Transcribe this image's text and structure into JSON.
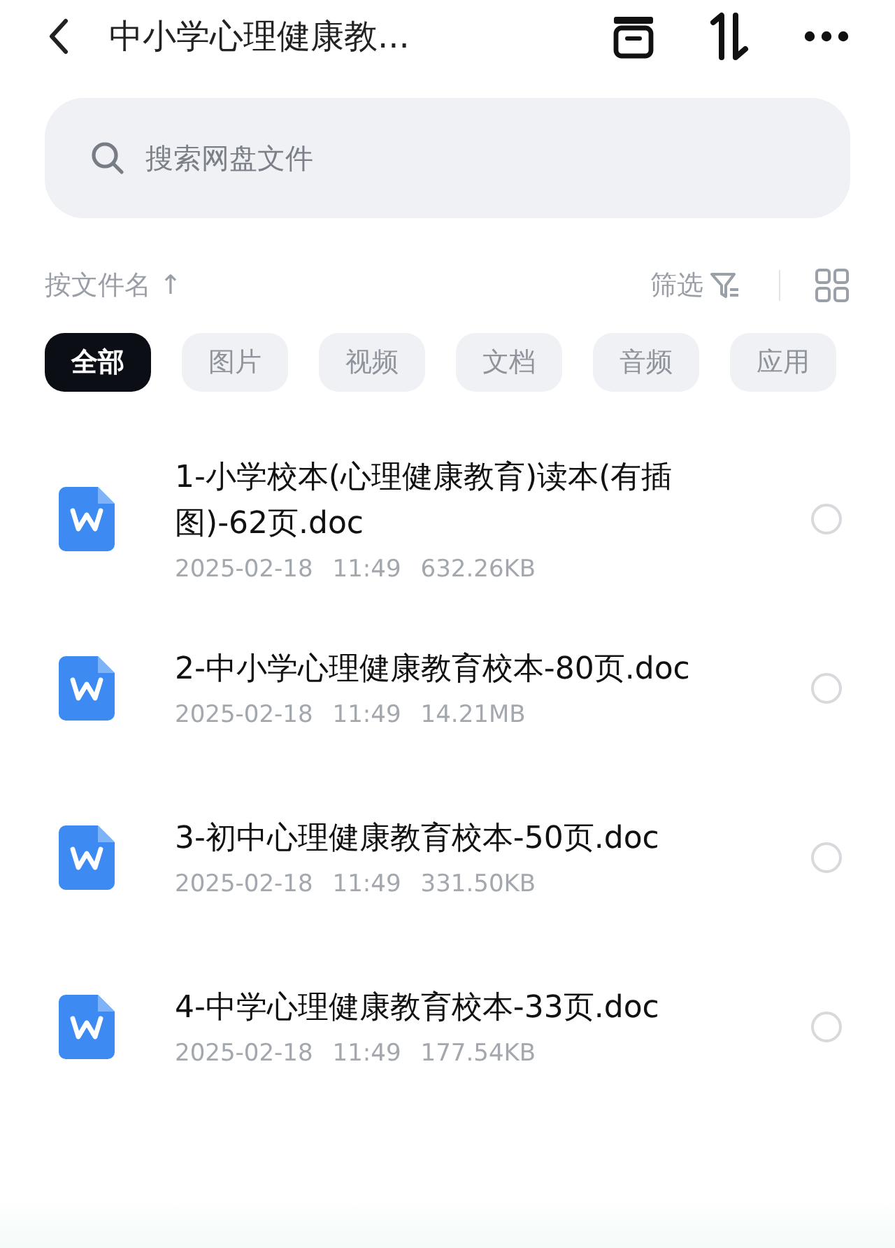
{
  "header": {
    "title": "中小学心理健康教..."
  },
  "search": {
    "placeholder": "搜索网盘文件"
  },
  "sort": {
    "label": "按文件名 ↑"
  },
  "filter": {
    "label": "筛选"
  },
  "chips": [
    {
      "label": "全部",
      "selected": true
    },
    {
      "label": "图片",
      "selected": false
    },
    {
      "label": "视频",
      "selected": false
    },
    {
      "label": "文档",
      "selected": false
    },
    {
      "label": "音频",
      "selected": false
    },
    {
      "label": "应用",
      "selected": false
    }
  ],
  "files": [
    {
      "name": "1-小学校本(心理健康教育)读本(有插图)-62页.doc",
      "date": "2025-02-18",
      "time": "11:49",
      "size": "632.26KB",
      "selected": false
    },
    {
      "name": "2-中小学心理健康教育校本-80页.doc",
      "date": "2025-02-18",
      "time": "11:49",
      "size": "14.21MB",
      "selected": false
    },
    {
      "name": "3-初中心理健康教育校本-50页.doc",
      "date": "2025-02-18",
      "time": "11:49",
      "size": "331.50KB",
      "selected": false
    },
    {
      "name": "4-中学心理健康教育校本-33页.doc",
      "date": "2025-02-18",
      "time": "11:49",
      "size": "177.54KB",
      "selected": false
    }
  ]
}
